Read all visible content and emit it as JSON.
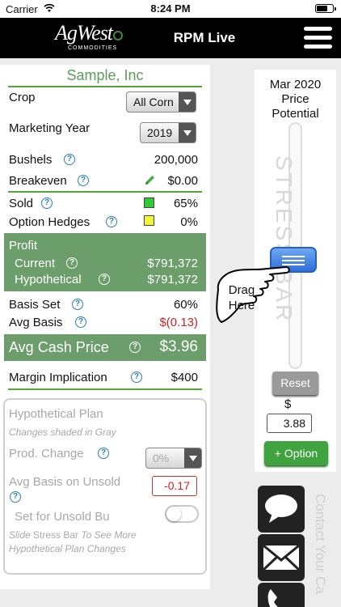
{
  "status_bar": {
    "carrier": "Carrier",
    "time": "8:24 PM"
  },
  "header": {
    "logo_text": "AgWest",
    "logo_subtext": "COMMODITIES",
    "title": "RPM Live"
  },
  "company_name": "Sample, Inc",
  "crop": {
    "label": "Crop",
    "selected": "All Corn"
  },
  "marketing_year": {
    "label": "Marketing Year",
    "selected": "2019"
  },
  "bushels": {
    "label": "Bushels",
    "value": "200,000"
  },
  "breakeven": {
    "label": "Breakeven",
    "value": "$0.00"
  },
  "sold": {
    "label": "Sold",
    "value": "65%",
    "color": "#2ecc2e"
  },
  "option_hedges": {
    "label": "Option Hedges",
    "value": "0%",
    "color": "#f5f53a"
  },
  "profit": {
    "label": "Profit",
    "current_label": "Current",
    "current_value": "$791,372",
    "hypothetical_label": "Hypothetical",
    "hypothetical_value": "$791,372"
  },
  "basis_set": {
    "label": "Basis Set",
    "value": "60%"
  },
  "avg_basis": {
    "label": "Avg Basis",
    "value": "$(0.13)",
    "color": "#d42020"
  },
  "avg_cash_price": {
    "label": "Avg Cash Price",
    "value": "$3.96"
  },
  "margin_implication": {
    "label": "Margin Implication",
    "value": "$400"
  },
  "hypothetical_plan": {
    "title": "Hypothetical Plan",
    "subtitle": "Changes shaded in Gray",
    "prod_change_label": "Prod. Change",
    "prod_change_value": "0%",
    "avg_basis_unsold_label": "Avg Basis on Unsold",
    "avg_basis_unsold_value": "-0.17",
    "set_unsold_label": "Set for Unsold Bu",
    "hint_pre": "Slide",
    "hint_bold": "Stress Bar",
    "hint_post": "To See More Hypothetical Plan Changes"
  },
  "price_potential": {
    "title_line1": "Mar 2020",
    "title_line2": "Price",
    "title_line3": "Potential",
    "stress_bar_text": "STRESS BAR",
    "reset_label": "Reset",
    "dollar_label": "$",
    "price_value": "3.88",
    "option_button_label": "+ Option"
  },
  "drag_hint": {
    "line1": "Drag",
    "line2": "Here"
  },
  "contact": {
    "text": "Contact Your Ca"
  },
  "colors": {
    "accent_green": "#58a33a",
    "profit_green": "#6c9e6c",
    "header_black": "#000000"
  },
  "icons": [
    "wifi-icon",
    "battery-icon",
    "hamburger-menu-icon",
    "help-icon",
    "pencil-icon",
    "hand-pointer-icon",
    "chat-icon",
    "mail-icon",
    "phone-icon"
  ]
}
